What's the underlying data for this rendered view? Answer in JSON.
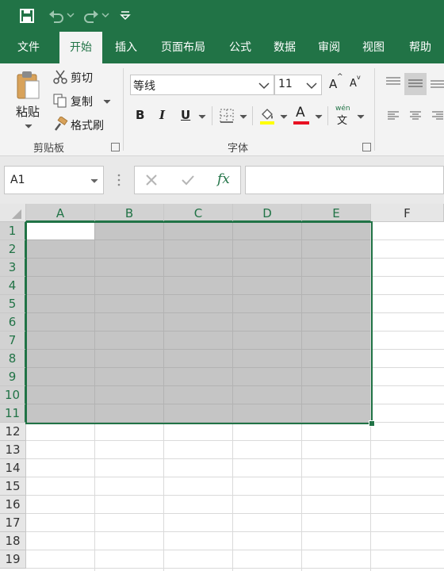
{
  "menu": {
    "tabs": [
      {
        "label": "文件"
      },
      {
        "label": "开始"
      },
      {
        "label": "插入"
      },
      {
        "label": "页面布局"
      },
      {
        "label": "公式"
      },
      {
        "label": "数据"
      },
      {
        "label": "审阅"
      },
      {
        "label": "视图"
      },
      {
        "label": "帮助"
      }
    ],
    "active_tab": "开始"
  },
  "clipboard": {
    "paste_label": "粘贴",
    "cut_label": "剪切",
    "copy_label": "复制",
    "format_painter_label": "格式刷",
    "group_label": "剪贴板"
  },
  "font": {
    "name_value": "等线",
    "size_value": "11",
    "bold_label": "B",
    "italic_label": "I",
    "underline_label": "U",
    "font_color_label": "A",
    "grow_label": "A",
    "shrink_label": "A",
    "phonetic_top": "wén",
    "phonetic_char": "文",
    "group_label": "字体",
    "highlight_color": "#ffff00",
    "font_color": "#e81123"
  },
  "formula_bar": {
    "name_box_value": "A1",
    "fx_label": "fx",
    "formula_value": ""
  },
  "grid": {
    "columns": [
      "A",
      "B",
      "C",
      "D",
      "E",
      "F"
    ],
    "rows": [
      "1",
      "2",
      "3",
      "4",
      "5",
      "6",
      "7",
      "8",
      "9",
      "10",
      "11",
      "12",
      "13",
      "14",
      "15",
      "16",
      "17",
      "18",
      "19"
    ],
    "selection": "A1:E11",
    "accent_color": "#217346"
  }
}
